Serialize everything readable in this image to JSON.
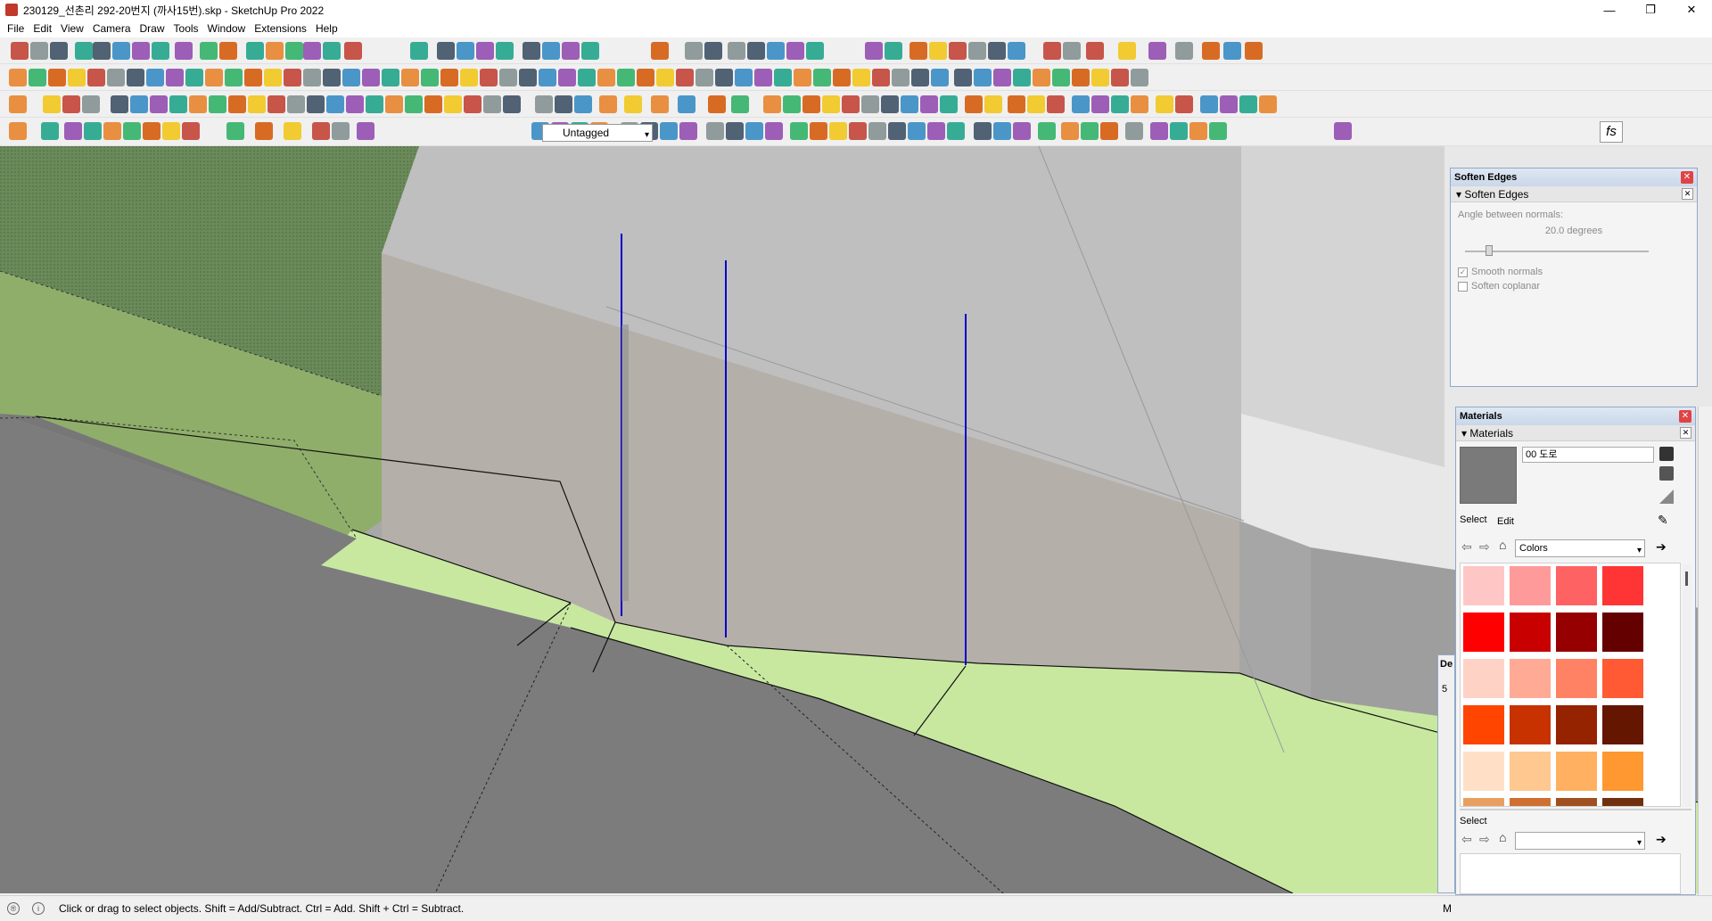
{
  "window": {
    "title": "230129_선촌리 292-20번지 (까사15번).skp - SketchUp Pro 2022",
    "minimize": "—",
    "maximize": "❐",
    "close": "✕"
  },
  "menu": [
    "File",
    "Edit",
    "View",
    "Camera",
    "Draw",
    "Tools",
    "Window",
    "Extensions",
    "Help"
  ],
  "toolbar": {
    "tag_selected": "Untagged",
    "fs_label": "fs"
  },
  "soften_panel": {
    "title": "Soften Edges",
    "section": "Soften Edges",
    "angle_label": "Angle between normals:",
    "angle_value": "20.0  degrees",
    "angle_fraction": 0.11,
    "smooth_normals_label": "Smooth normals",
    "smooth_normals_checked": true,
    "soften_coplanar_label": "Soften coplanar",
    "soften_coplanar_checked": false
  },
  "materials_panel": {
    "title": "Materials",
    "section": "Materials",
    "material_name": "00 도로",
    "tab_select": "Select",
    "tab_edit": "Edit",
    "library": "Colors",
    "lower_label": "Select",
    "lower_library": "",
    "swatches": [
      "#ffc6c6",
      "#ff9a9a",
      "#ff6262",
      "#ff3434",
      "#ff0000",
      "#c80000",
      "#960000",
      "#640000",
      "#ffd2c6",
      "#ffaa94",
      "#ff8264",
      "#ff5a34",
      "#ff4500",
      "#c83200",
      "#962300",
      "#641600",
      "#ffe0c6",
      "#ffc890",
      "#ffb060",
      "#ff9830"
    ]
  },
  "hidden_panel_fragment": {
    "heading_fragment": "De",
    "value_fragment": "5"
  },
  "status": {
    "message": "Click or drag to select objects. Shift = Add/Subtract. Ctrl = Add. Shift + Ctrl = Subtract.",
    "measurements_fragment": "M"
  },
  "colors": {
    "grass": "#9dbb6a",
    "grass_light": "#c8e8a0",
    "road": "#7a7a7a",
    "wall": "#b2aeaa",
    "sky": "#c4c4c4",
    "axis_blue": "#0000cc"
  }
}
